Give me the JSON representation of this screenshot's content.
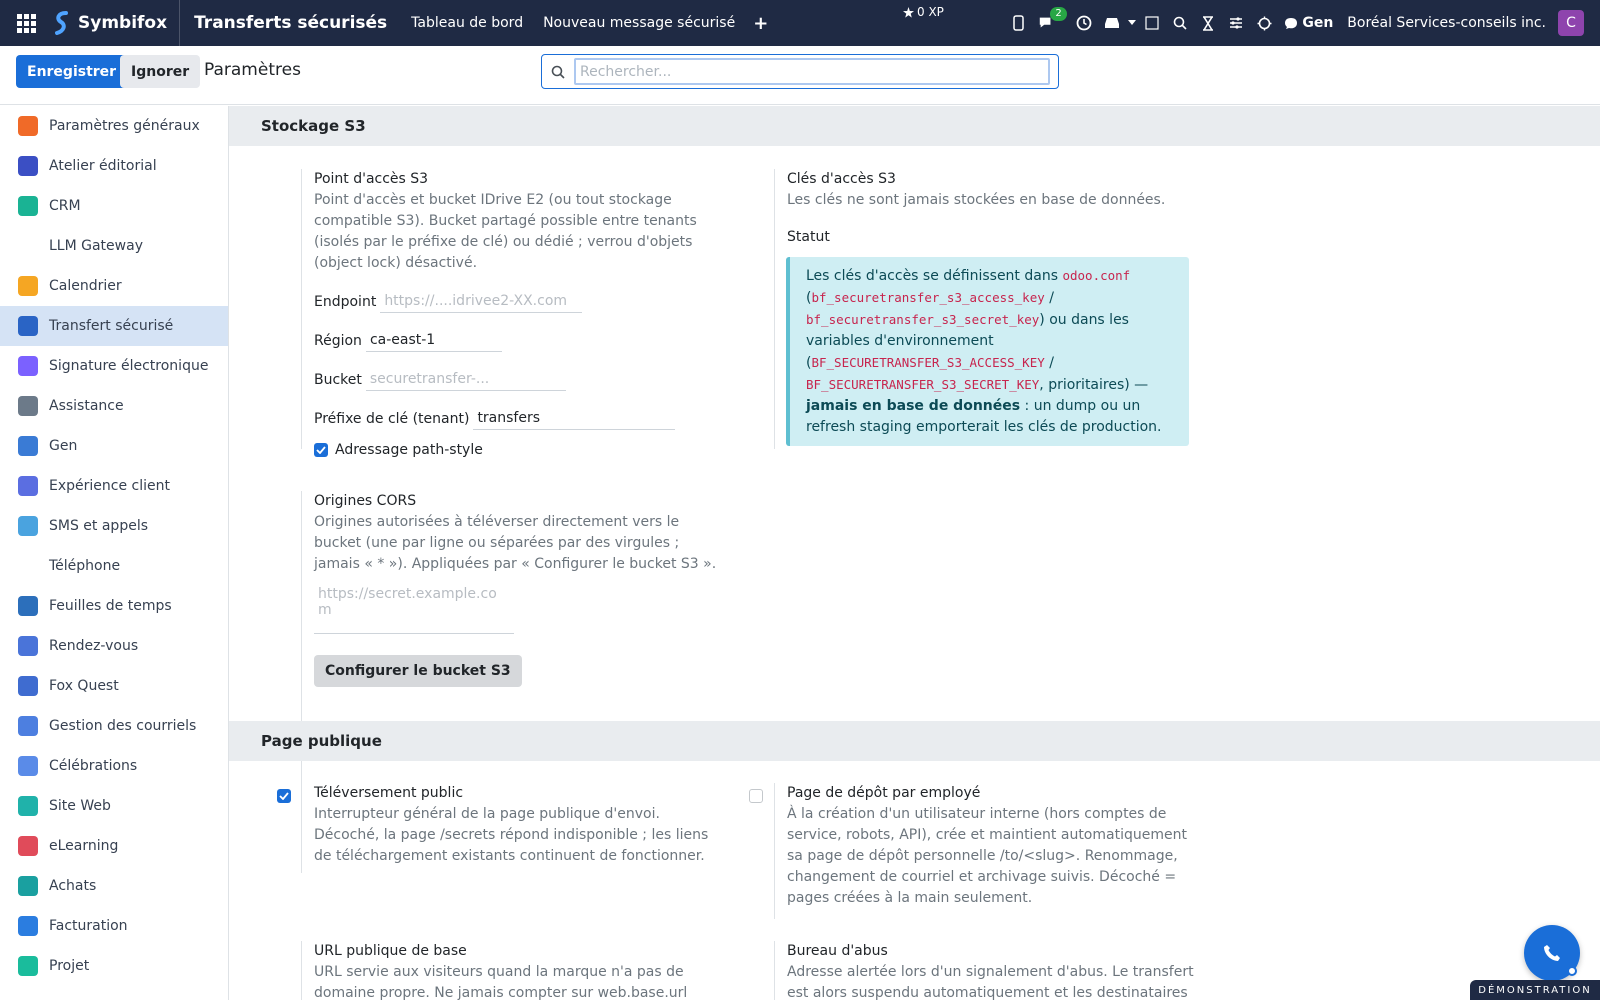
{
  "navbar": {
    "brand": "Symbifox",
    "app_title": "Transferts sécurisés",
    "links": [
      "Tableau de bord",
      "Nouveau message sécurisé"
    ],
    "plus": "+",
    "xp": "0 XP",
    "chat_count": "2",
    "gen_label": "Gen",
    "company": "Boréal Services-conseils inc.",
    "avatar_letter": "C"
  },
  "control": {
    "save_label": "Enregistrer",
    "ignore_label": "Ignorer",
    "title": "Paramètres",
    "search_placeholder": "Rechercher..."
  },
  "sidebar": {
    "items": [
      {
        "label": "Paramètres généraux",
        "color": "#f06a28"
      },
      {
        "label": "Atelier éditorial",
        "color": "#3b4fc4"
      },
      {
        "label": "CRM",
        "color": "#1ab394"
      },
      {
        "label": "LLM Gateway",
        "color": ""
      },
      {
        "label": "Calendrier",
        "color": "#f5a623"
      },
      {
        "label": "Transfert sécurisé",
        "color": "#2a64c5",
        "active": true
      },
      {
        "label": "Signature électronique",
        "color": "#7b61ff"
      },
      {
        "label": "Assistance",
        "color": "#6c7a89"
      },
      {
        "label": "Gen",
        "color": "#3a7bd5"
      },
      {
        "label": "Expérience client",
        "color": "#5b6ee1"
      },
      {
        "label": "SMS et appels",
        "color": "#4aa3df"
      },
      {
        "label": "Téléphone",
        "color": ""
      },
      {
        "label": "Feuilles de temps",
        "color": "#2c6fbb"
      },
      {
        "label": "Rendez-vous",
        "color": "#4a74d9"
      },
      {
        "label": "Fox Quest",
        "color": "#3f6cd0"
      },
      {
        "label": "Gestion des courriels",
        "color": "#4d7fe0"
      },
      {
        "label": "Célébrations",
        "color": "#5a8be8"
      },
      {
        "label": "Site Web",
        "color": "#20b2aa"
      },
      {
        "label": "eLearning",
        "color": "#e04b5a"
      },
      {
        "label": "Achats",
        "color": "#1aa0a0"
      },
      {
        "label": "Facturation",
        "color": "#2b7de0"
      },
      {
        "label": "Projet",
        "color": "#1abc9c"
      }
    ]
  },
  "s3": {
    "section_title": "Stockage S3",
    "endpoint_block": {
      "title": "Point d'accès S3",
      "desc": "Point d'accès et bucket IDrive E2 (ou tout stockage compatible S3). Bucket partagé possible entre tenants (isolés par le préfixe de clé) ou dédié ; verrou d'objets (object lock) désactivé.",
      "endpoint_label": "Endpoint",
      "endpoint_placeholder": "https://....idrivee2-XX.com",
      "region_label": "Région",
      "region_value": "ca-east-1",
      "bucket_label": "Bucket",
      "bucket_placeholder": "securetransfer-...",
      "prefix_label": "Préfixe de clé (tenant)",
      "prefix_value": "transfers",
      "pathstyle_label": "Adressage path-style"
    },
    "cors": {
      "title": "Origines CORS",
      "desc": "Origines autorisées à téléverser directement vers le bucket (une par ligne ou séparées par des virgules ; jamais « * »). Appliquées par « Configurer le bucket S3 ».",
      "placeholder": "https://secret.example.com",
      "button": "Configurer le bucket S3"
    },
    "keys": {
      "title": "Clés d'accès S3",
      "desc": "Les clés ne sont jamais stockées en base de données.",
      "status_label": "Statut",
      "alert_1": "Les clés d'accès se définissent dans ",
      "alert_code_1": "odoo.conf",
      "alert_2": "(",
      "alert_code_2": "bf_securetransfer_s3_access_key",
      "alert_3": " / ",
      "alert_code_3": "bf_securetransfer_s3_secret_key",
      "alert_4": ") ou dans les variables d'environnement (",
      "alert_code_4": "BF_SECURETRANSFER_S3_ACCESS_KEY",
      "alert_5": " / ",
      "alert_code_5": "BF_SECURETRANSFER_S3_SECRET_KEY",
      "alert_6": ", prioritaires) —",
      "alert_bold": "jamais en base de données",
      "alert_7": " : un dump ou un refresh staging emporterait les clés de production."
    }
  },
  "public": {
    "section_title": "Page publique",
    "upload": {
      "title": "Téléversement public",
      "desc": "Interrupteur général de la page publique d'envoi. Décoché, la page /secrets répond indisponible ; les liens de téléchargement existants continuent de fonctionner."
    },
    "dropbox": {
      "title": "Page de dépôt par employé",
      "desc": "À la création d'un utilisateur interne (hors comptes de service, robots, API), crée et maintient automatiquement sa page de dépôt personnelle /to/<slug>. Renommage, changement de courriel et archivage suivis. Décoché = pages créées à la main seulement."
    },
    "base_url": {
      "title": "URL publique de base",
      "desc": "URL servie aux visiteurs quand la marque n'a pas de domaine propre. Ne jamais compter sur web.base.url (gelé"
    },
    "abuse": {
      "title": "Bureau d'abus",
      "desc": "Adresse alertée lors d'un signalement d'abus. Le transfert est alors suspendu automatiquement et les destinataires"
    }
  },
  "footer": {
    "demo_label": "DÉMONSTRATION"
  }
}
